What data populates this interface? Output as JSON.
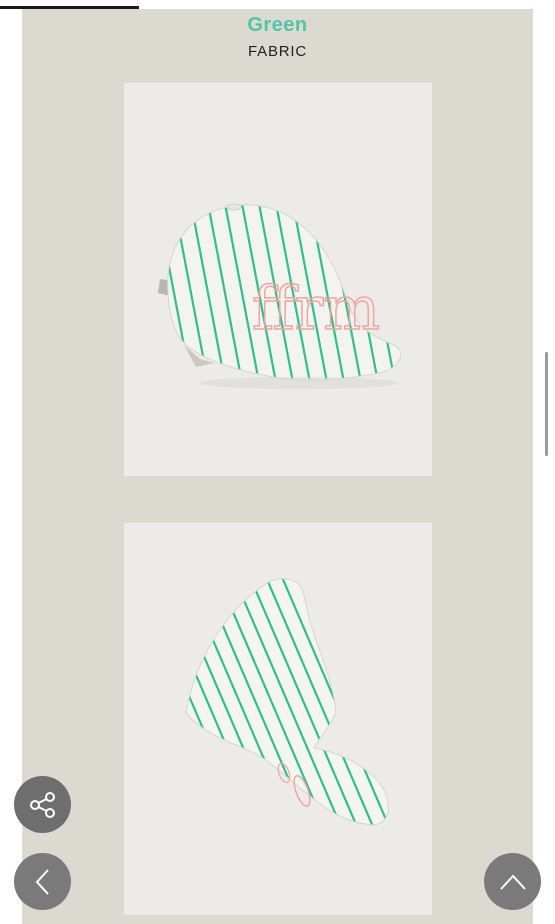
{
  "product": {
    "color_name": "Green",
    "fabric_label": "FABRIC",
    "cap_embroidery": "ffrm"
  },
  "colors": {
    "accent": "#52c4a6",
    "panel_bg": "#dcd9d1",
    "photo_bg": "#ecebea",
    "stripe": "#2fbf90",
    "embroidery": "#f2a3a0"
  },
  "progress": {
    "fraction": 0.25
  },
  "icons": {
    "share": "share-icon",
    "back": "chevron-left-icon",
    "top": "chevron-up-icon"
  }
}
